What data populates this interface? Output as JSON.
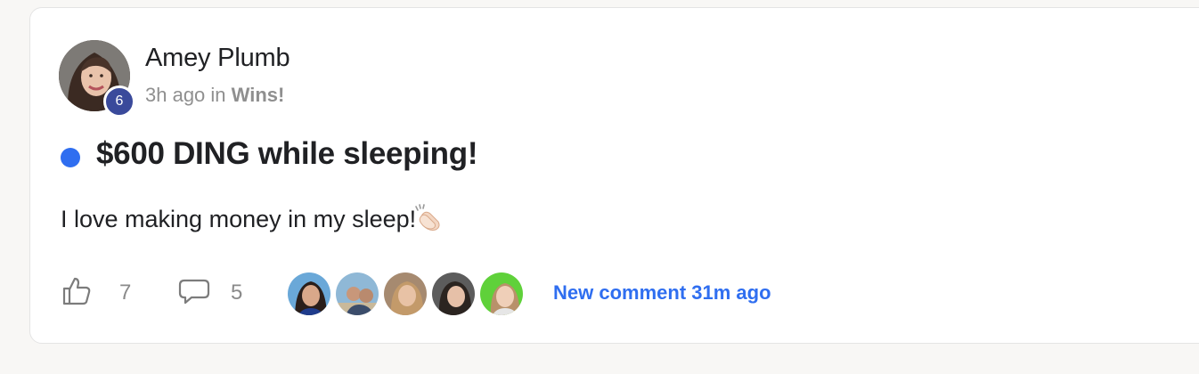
{
  "post": {
    "author": {
      "name": "Amey Plumb",
      "level": "6",
      "avatar_icon": "user-avatar"
    },
    "meta": {
      "time": "3h ago",
      "in": "in",
      "category": "Wins!"
    },
    "unread": true,
    "title": "$600 DING while sleeping!",
    "body": "I love making money in my sleep!",
    "body_emoji_icon": "clapping-hands-icon",
    "likes": {
      "icon": "thumbs-up-icon",
      "count": "7"
    },
    "comments": {
      "icon": "comment-bubble-icon",
      "count": "5"
    },
    "commenters": [
      {
        "avatar_icon": "commenter-avatar"
      },
      {
        "avatar_icon": "commenter-avatar"
      },
      {
        "avatar_icon": "commenter-avatar"
      },
      {
        "avatar_icon": "commenter-avatar"
      },
      {
        "avatar_icon": "commenter-avatar"
      }
    ],
    "new_comment_link": "New comment 31m ago"
  },
  "colors": {
    "accent": "#2f6ef0",
    "level_badge": "#3a4a9b",
    "muted_text": "#8f8f8f",
    "text": "#202124"
  }
}
